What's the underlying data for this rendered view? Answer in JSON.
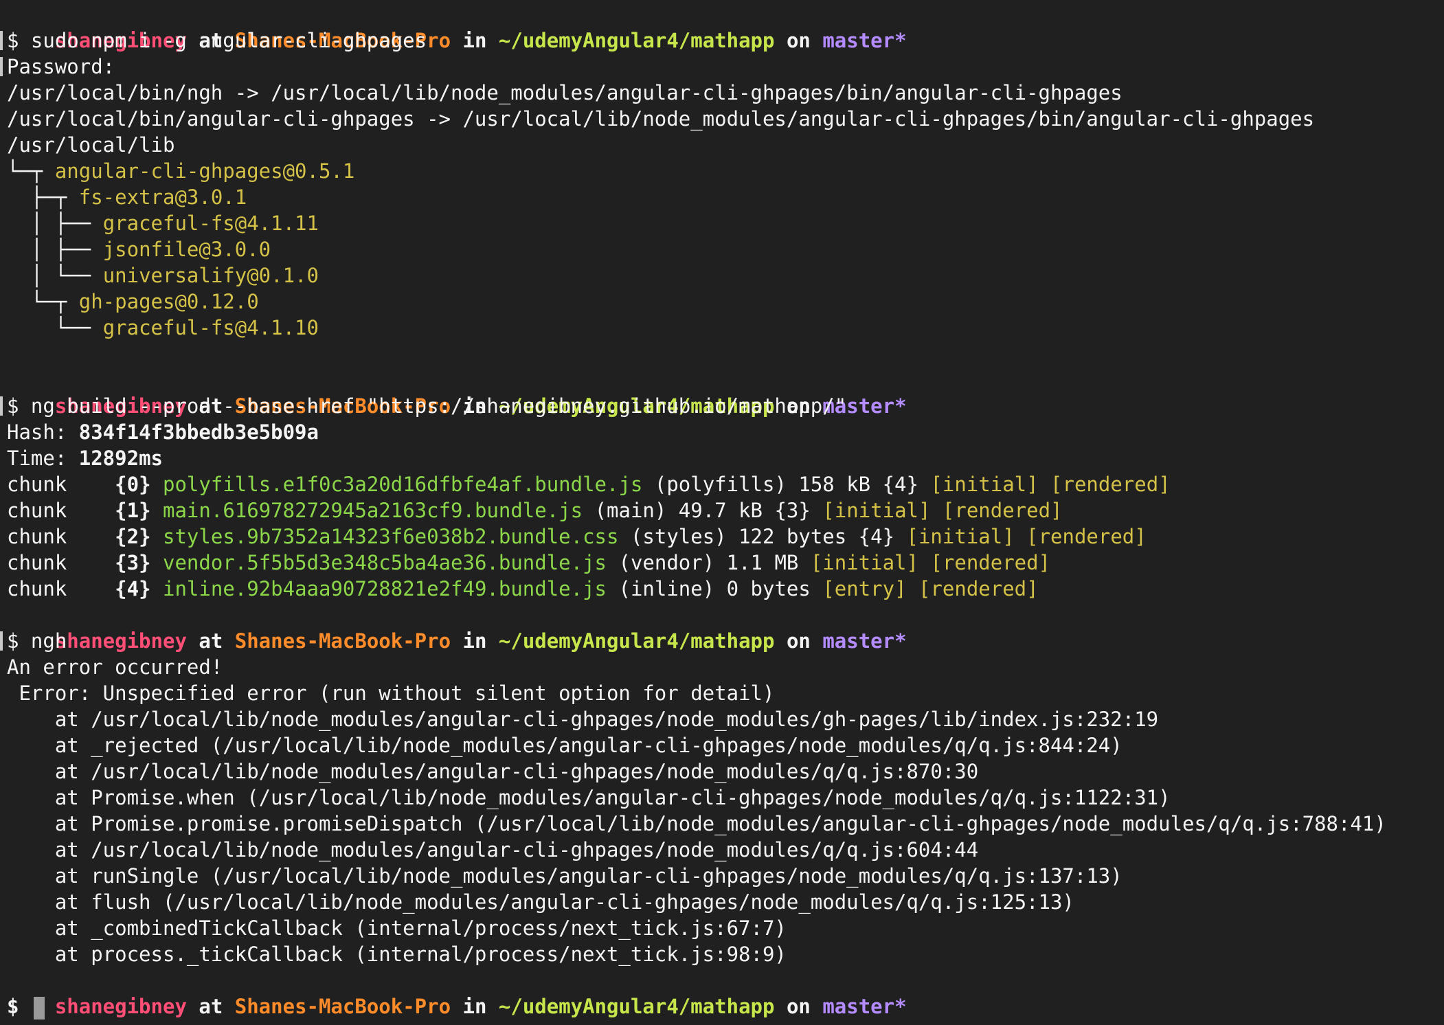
{
  "prompt": {
    "user": "shanegibney",
    "at": "at",
    "host": "Shanes-MacBook-Pro",
    "in": "in",
    "path": "~/udemyAngular4/mathapp",
    "on": "on",
    "branch": "master*"
  },
  "lines": {
    "l1": "$ sudo npm i -g angular-cli-ghpages",
    "l2": "Password:",
    "l3": "/usr/local/bin/ngh -> /usr/local/lib/node_modules/angular-cli-ghpages/bin/angular-cli-ghpages",
    "l4": "/usr/local/bin/angular-cli-ghpages -> /usr/local/lib/node_modules/angular-cli-ghpages/bin/angular-cli-ghpages",
    "l5": "/usr/local/lib",
    "t1_prefix": "└─┬ ",
    "t1": "angular-cli-ghpages@0.5.1",
    "t2_prefix": "  ├─┬ ",
    "t2": "fs-extra@3.0.1",
    "t3_prefix": "  │ ├── ",
    "t3": "graceful-fs@4.1.11",
    "t4_prefix": "  │ ├── ",
    "t4": "jsonfile@3.0.0",
    "t5_prefix": "  │ └── ",
    "t5": "universalify@0.1.0",
    "t6_prefix": "  └─┬ ",
    "t6": "gh-pages@0.12.0",
    "t7_prefix": "    └── ",
    "t7": "graceful-fs@4.1.10",
    "cmd2": "$ ng build --prod --base-href \"https://shanegibney.github.io/mathapp/\"",
    "hash_label": "Hash: ",
    "hash_value": "834f14f3bbedb3e5b09a",
    "time_label": "Time: ",
    "time_value": "12892ms",
    "cmd3": "$ ngh",
    "err1": "An error occurred!",
    "err2": " Error: Unspecified error (run without silent option for detail)",
    "st1": "    at /usr/local/lib/node_modules/angular-cli-ghpages/node_modules/gh-pages/lib/index.js:232:19",
    "st2": "    at _rejected (/usr/local/lib/node_modules/angular-cli-ghpages/node_modules/q/q.js:844:24)",
    "st3": "    at /usr/local/lib/node_modules/angular-cli-ghpages/node_modules/q/q.js:870:30",
    "st4": "    at Promise.when (/usr/local/lib/node_modules/angular-cli-ghpages/node_modules/q/q.js:1122:31)",
    "st5": "    at Promise.promise.promiseDispatch (/usr/local/lib/node_modules/angular-cli-ghpages/node_modules/q/q.js:788:41)",
    "st6": "    at /usr/local/lib/node_modules/angular-cli-ghpages/node_modules/q/q.js:604:44",
    "st7": "    at runSingle (/usr/local/lib/node_modules/angular-cli-ghpages/node_modules/q/q.js:137:13)",
    "st8": "    at flush (/usr/local/lib/node_modules/angular-cli-ghpages/node_modules/q/q.js:125:13)",
    "st9": "    at _combinedTickCallback (internal/process/next_tick.js:67:7)",
    "st10": "    at process._tickCallback (internal/process/next_tick.js:98:9)",
    "last_prompt": "$ "
  },
  "chunks": [
    {
      "label": "chunk",
      "id": "{0}",
      "file": "polyfills.e1f0c3a20d16dfbfe4af.bundle.js",
      "desc": " (polyfills) 158 kB {4} ",
      "tags": "[initial] [rendered]"
    },
    {
      "label": "chunk",
      "id": "{1}",
      "file": "main.616978272945a2163cf9.bundle.js",
      "desc": " (main) 49.7 kB {3} ",
      "tags": "[initial] [rendered]"
    },
    {
      "label": "chunk",
      "id": "{2}",
      "file": "styles.9b7352a14323f6e038b2.bundle.css",
      "desc": " (styles) 122 bytes {4} ",
      "tags": "[initial] [rendered]"
    },
    {
      "label": "chunk",
      "id": "{3}",
      "file": "vendor.5f5b5d3e348c5ba4ae36.bundle.js",
      "desc": " (vendor) 1.1 MB ",
      "tags": "[initial] [rendered]"
    },
    {
      "label": "chunk",
      "id": "{4}",
      "file": "inline.92b4aaa90728821e2f49.bundle.js",
      "desc": " (inline) 0 bytes ",
      "tags": "[entry] [rendered]"
    }
  ],
  "colors": {
    "background": "#202020",
    "user": "#ff4f77",
    "host": "#ff8c2a",
    "path": "#c7e64c",
    "branch": "#b48cff",
    "package": "#d4c148",
    "bundle": "#8cd64a"
  }
}
